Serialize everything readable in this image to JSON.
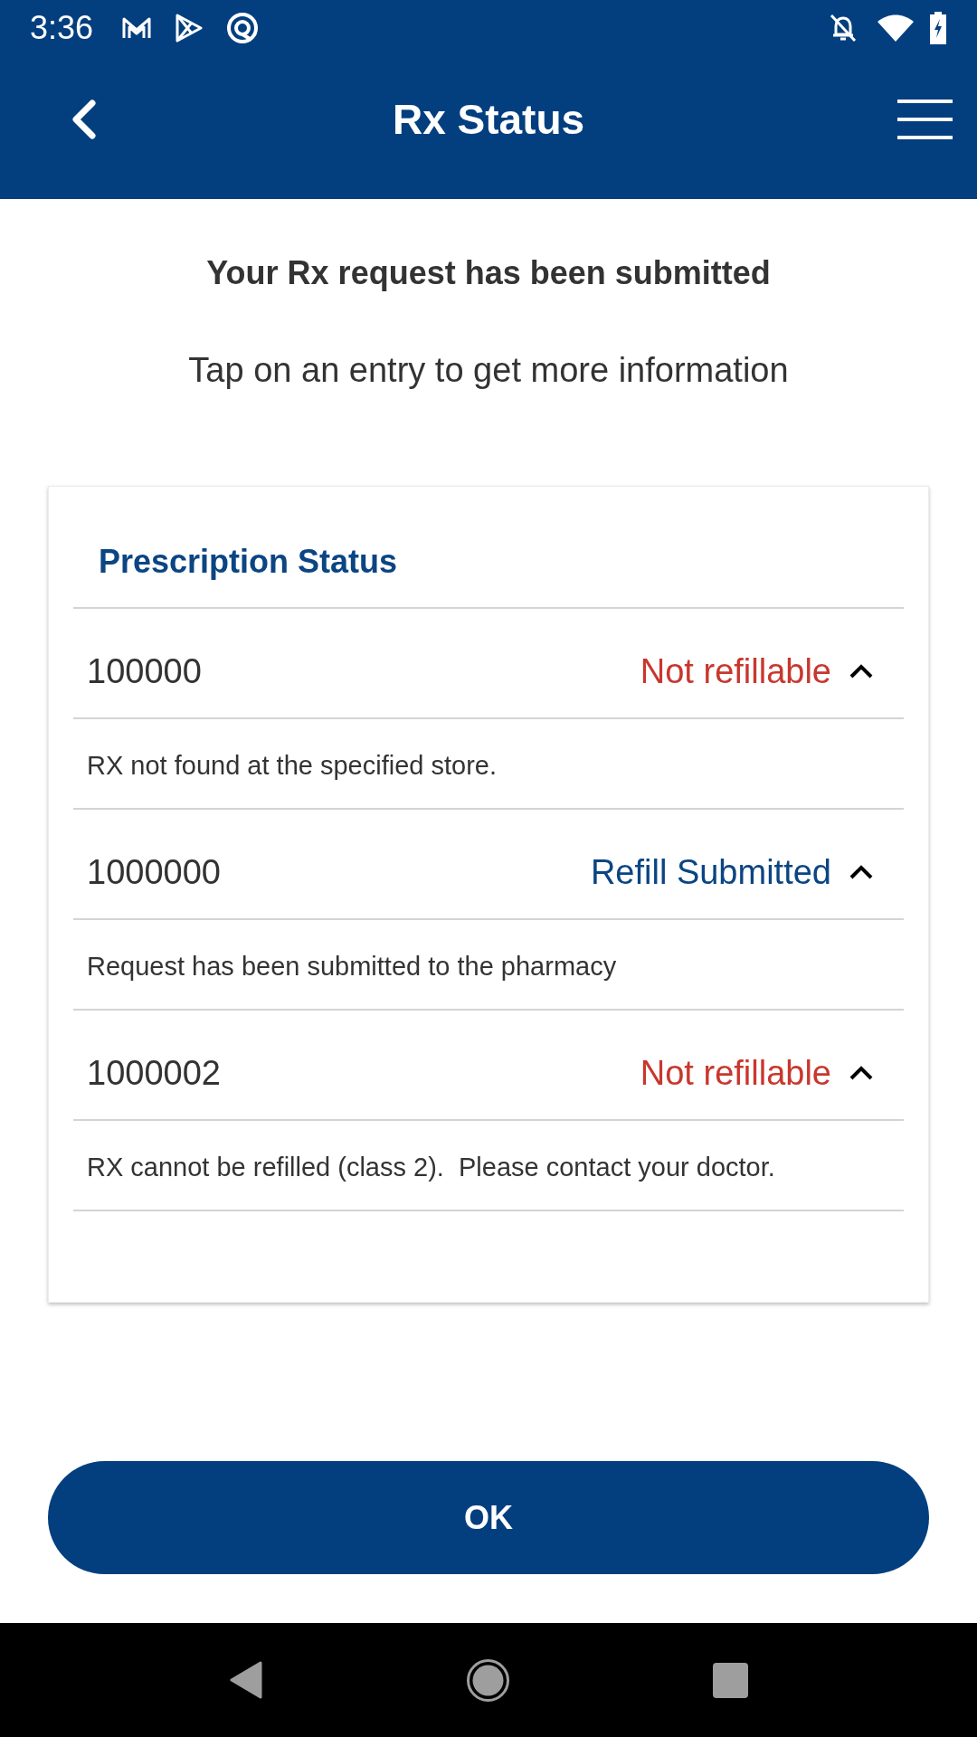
{
  "status_bar": {
    "time": "3:36"
  },
  "app_bar": {
    "title": "Rx Status"
  },
  "message": {
    "heading": "Your Rx request has been submitted",
    "subtext": "Tap on an entry to get more information"
  },
  "card": {
    "title": "Prescription Status",
    "entries": [
      {
        "rx_number": "100000",
        "status": "Not refillable",
        "color": "#c8372d",
        "expanded": true,
        "detail": "RX not found at the specified store."
      },
      {
        "rx_number": "1000000",
        "status": "Refill Submitted",
        "color": "#0b4583",
        "expanded": true,
        "detail": "Request has been submitted to the pharmacy"
      },
      {
        "rx_number": "1000002",
        "status": "Not refillable",
        "color": "#c8372d",
        "expanded": true,
        "detail": "RX cannot be refilled (class 2).  Please contact your doctor."
      }
    ]
  },
  "ok_button": {
    "label": "OK"
  }
}
